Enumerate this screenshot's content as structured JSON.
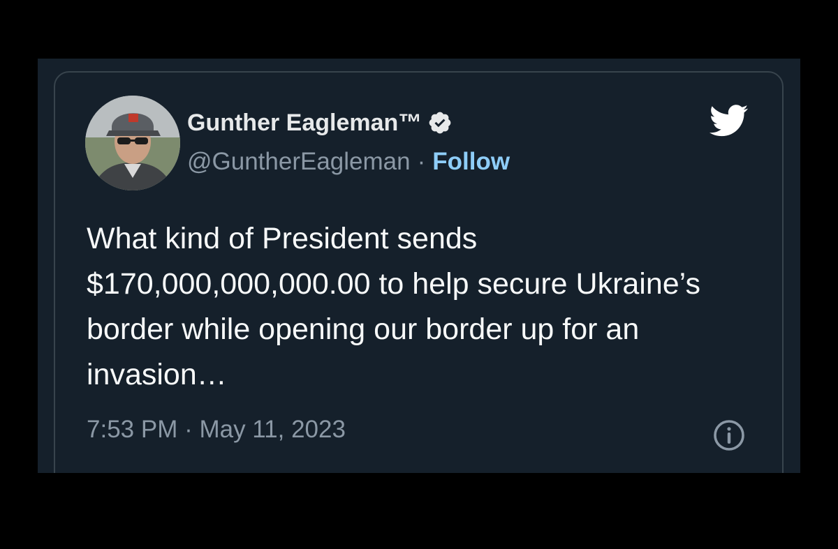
{
  "tweet": {
    "author": {
      "display_name": "Gunther Eagleman™",
      "handle": "@GuntherEagleman",
      "verified_icon": "verified-badge-icon",
      "avatar": "profile-photo"
    },
    "separator": "·",
    "follow_label": "Follow",
    "text": "What kind of President sends $170,000,000,000.00 to help secure Ukraine’s border while opening our border up for an invasion…",
    "timestamp": "7:53 PM · May 11, 2023",
    "brand_icon": "twitter-bird-icon",
    "info_icon": "info-icon"
  },
  "colors": {
    "background": "#15202b",
    "frame": "#000000",
    "card_border": "#38444d",
    "primary_text": "#e7e9ea",
    "secondary_text": "#8b98a5",
    "follow": "#8ecdf8",
    "twitter_blue": "#ffffff"
  }
}
